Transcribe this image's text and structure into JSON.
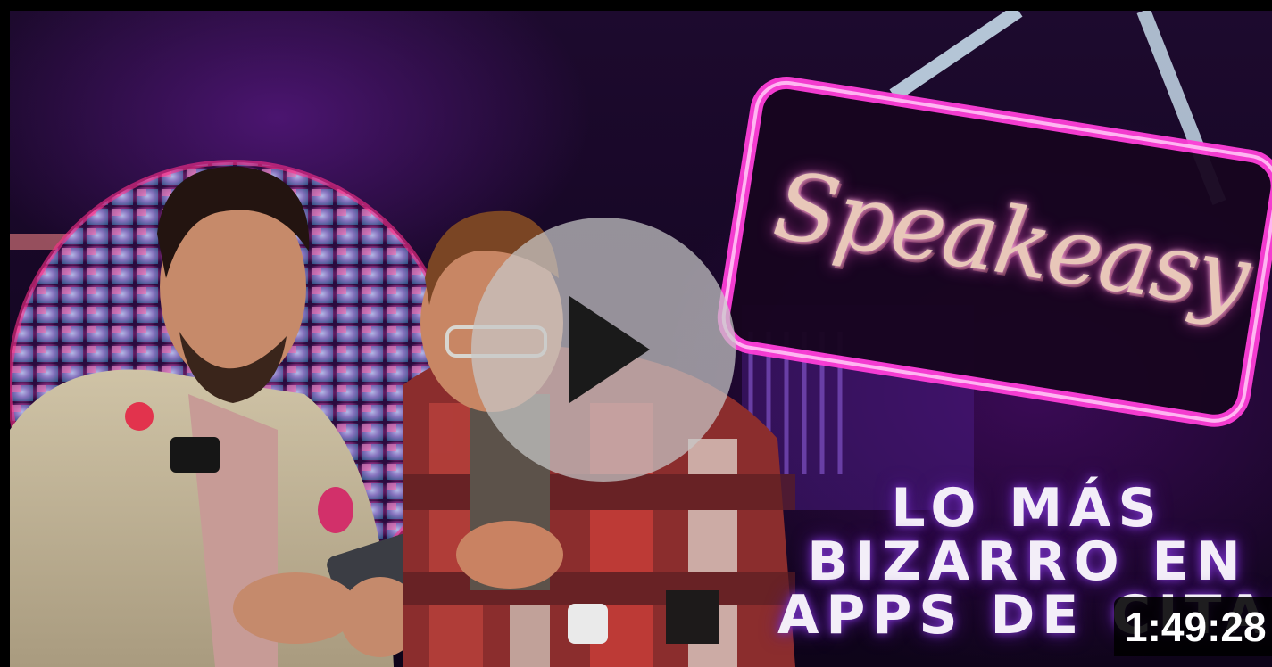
{
  "video": {
    "logo_text": "Speakeasy",
    "headline_lines": [
      "LO MÁS",
      "BIZARRO EN",
      "APPS DE CITAS"
    ],
    "duration": "1:49:28"
  },
  "icons": {
    "play": "play-icon"
  },
  "colors": {
    "neon_pink": "#ff3fd8",
    "neon_purple": "#7a35c9",
    "play_button_bg": "#c8c8c8",
    "duration_bg": "#000000"
  }
}
